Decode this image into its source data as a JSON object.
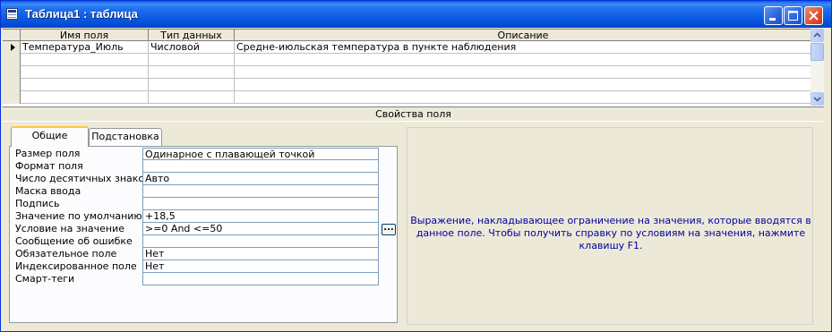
{
  "window": {
    "title": "Таблица1 : таблица"
  },
  "grid": {
    "headers": [
      "Имя поля",
      "Тип данных",
      "Описание"
    ],
    "rows": [
      {
        "name": "Температура_Июль",
        "type": "Числовой",
        "description": "Средне-июльская температура в пункте наблюдения"
      }
    ]
  },
  "props_title": "Свойства поля",
  "tabs": [
    {
      "label": "Общие",
      "active": true
    },
    {
      "label": "Подстановка",
      "active": false
    }
  ],
  "properties": [
    {
      "label": "Размер поля",
      "value": "Одинарное с плавающей точкой"
    },
    {
      "label": "Формат поля",
      "value": ""
    },
    {
      "label": "Число десятичных знаков",
      "value": "Авто"
    },
    {
      "label": "Маска ввода",
      "value": ""
    },
    {
      "label": "Подпись",
      "value": ""
    },
    {
      "label": "Значение по умолчанию",
      "value": "+18,5"
    },
    {
      "label": "Условие на значение",
      "value": ">=0 And <=50"
    },
    {
      "label": "Сообщение об ошибке",
      "value": ""
    },
    {
      "label": "Обязательное поле",
      "value": "Нет"
    },
    {
      "label": "Индексированное поле",
      "value": "Нет"
    },
    {
      "label": "Смарт-теги",
      "value": ""
    }
  ],
  "builder_button": "...",
  "help_text": "Выражение, накладывающее ограничение на значения, которые вводятся в данное поле.  Чтобы получить справку по условиям на значения, нажмите клавишу F1.",
  "colors": {
    "title_bar": "#0857e0",
    "help_text": "#0000a0",
    "window_bg": "#ece9d8",
    "tab_highlight": "#ffc73c"
  }
}
